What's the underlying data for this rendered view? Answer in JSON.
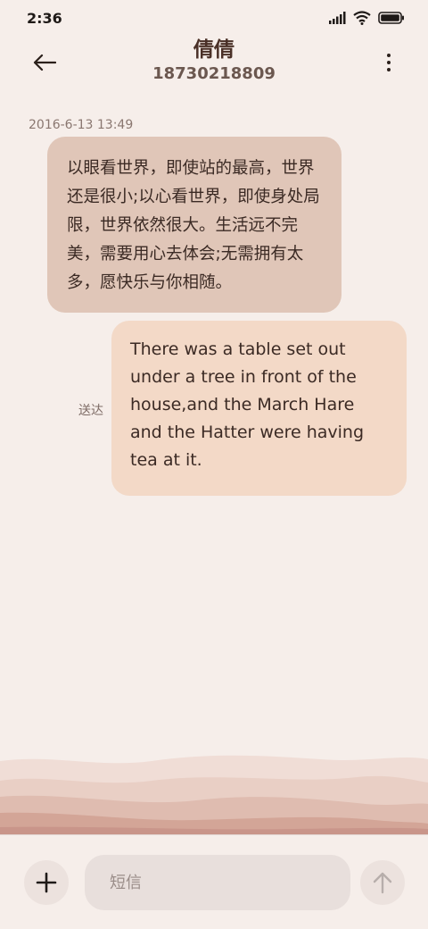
{
  "status_bar": {
    "time": "2:36",
    "icons": [
      "signal-icon",
      "wifi-icon",
      "battery-icon"
    ]
  },
  "header": {
    "contact_name": "倩倩",
    "contact_number": "18730218809",
    "back_icon": "back-arrow-icon",
    "menu_icon": "more-vertical-icon"
  },
  "conversation": {
    "timestamp": "2016-6-13 13:49",
    "messages": [
      {
        "direction": "incoming",
        "text": "以眼看世界，即使站的最高，世界还是很小;以心看世界，即使身处局限，世界依然很大。生活远不完美，需要用心去体会;无需拥有太多，愿快乐与你相随。"
      },
      {
        "direction": "outgoing",
        "text": "There was a table set out under a tree in front of the house,and the March Hare and the Hatter were having tea at it.",
        "status": "送达"
      }
    ]
  },
  "composer": {
    "placeholder": "短信",
    "value": "",
    "add_icon": "plus-icon",
    "send_icon": "send-arrow-up-icon"
  },
  "colors": {
    "background": "#f6eeea",
    "incoming_bubble": "#e0c6b8",
    "outgoing_bubble": "#f3d9c7",
    "input_background": "#e8dfdc"
  }
}
